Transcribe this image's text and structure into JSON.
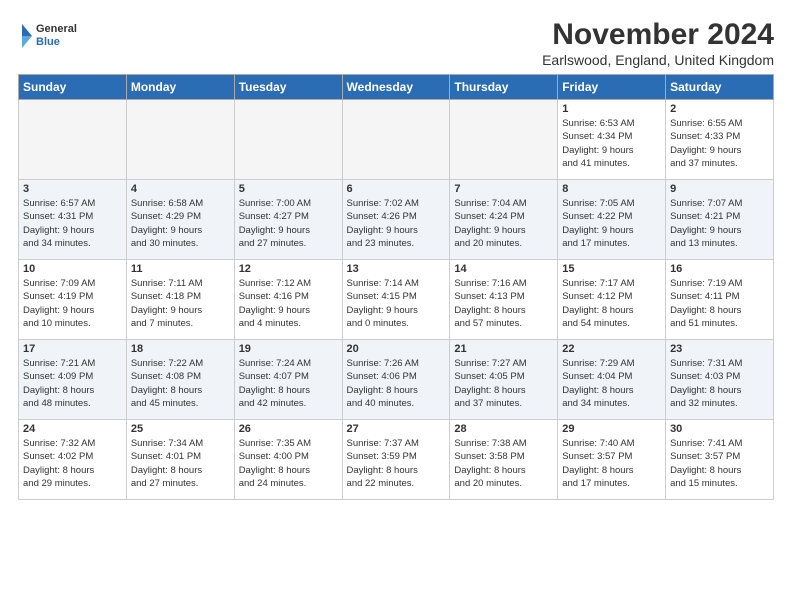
{
  "logo": {
    "general": "General",
    "blue": "Blue"
  },
  "title": "November 2024",
  "location": "Earlswood, England, United Kingdom",
  "weekdays": [
    "Sunday",
    "Monday",
    "Tuesday",
    "Wednesday",
    "Thursday",
    "Friday",
    "Saturday"
  ],
  "weeks": [
    [
      {
        "day": "",
        "info": ""
      },
      {
        "day": "",
        "info": ""
      },
      {
        "day": "",
        "info": ""
      },
      {
        "day": "",
        "info": ""
      },
      {
        "day": "",
        "info": ""
      },
      {
        "day": "1",
        "info": "Sunrise: 6:53 AM\nSunset: 4:34 PM\nDaylight: 9 hours\nand 41 minutes."
      },
      {
        "day": "2",
        "info": "Sunrise: 6:55 AM\nSunset: 4:33 PM\nDaylight: 9 hours\nand 37 minutes."
      }
    ],
    [
      {
        "day": "3",
        "info": "Sunrise: 6:57 AM\nSunset: 4:31 PM\nDaylight: 9 hours\nand 34 minutes."
      },
      {
        "day": "4",
        "info": "Sunrise: 6:58 AM\nSunset: 4:29 PM\nDaylight: 9 hours\nand 30 minutes."
      },
      {
        "day": "5",
        "info": "Sunrise: 7:00 AM\nSunset: 4:27 PM\nDaylight: 9 hours\nand 27 minutes."
      },
      {
        "day": "6",
        "info": "Sunrise: 7:02 AM\nSunset: 4:26 PM\nDaylight: 9 hours\nand 23 minutes."
      },
      {
        "day": "7",
        "info": "Sunrise: 7:04 AM\nSunset: 4:24 PM\nDaylight: 9 hours\nand 20 minutes."
      },
      {
        "day": "8",
        "info": "Sunrise: 7:05 AM\nSunset: 4:22 PM\nDaylight: 9 hours\nand 17 minutes."
      },
      {
        "day": "9",
        "info": "Sunrise: 7:07 AM\nSunset: 4:21 PM\nDaylight: 9 hours\nand 13 minutes."
      }
    ],
    [
      {
        "day": "10",
        "info": "Sunrise: 7:09 AM\nSunset: 4:19 PM\nDaylight: 9 hours\nand 10 minutes."
      },
      {
        "day": "11",
        "info": "Sunrise: 7:11 AM\nSunset: 4:18 PM\nDaylight: 9 hours\nand 7 minutes."
      },
      {
        "day": "12",
        "info": "Sunrise: 7:12 AM\nSunset: 4:16 PM\nDaylight: 9 hours\nand 4 minutes."
      },
      {
        "day": "13",
        "info": "Sunrise: 7:14 AM\nSunset: 4:15 PM\nDaylight: 9 hours\nand 0 minutes."
      },
      {
        "day": "14",
        "info": "Sunrise: 7:16 AM\nSunset: 4:13 PM\nDaylight: 8 hours\nand 57 minutes."
      },
      {
        "day": "15",
        "info": "Sunrise: 7:17 AM\nSunset: 4:12 PM\nDaylight: 8 hours\nand 54 minutes."
      },
      {
        "day": "16",
        "info": "Sunrise: 7:19 AM\nSunset: 4:11 PM\nDaylight: 8 hours\nand 51 minutes."
      }
    ],
    [
      {
        "day": "17",
        "info": "Sunrise: 7:21 AM\nSunset: 4:09 PM\nDaylight: 8 hours\nand 48 minutes."
      },
      {
        "day": "18",
        "info": "Sunrise: 7:22 AM\nSunset: 4:08 PM\nDaylight: 8 hours\nand 45 minutes."
      },
      {
        "day": "19",
        "info": "Sunrise: 7:24 AM\nSunset: 4:07 PM\nDaylight: 8 hours\nand 42 minutes."
      },
      {
        "day": "20",
        "info": "Sunrise: 7:26 AM\nSunset: 4:06 PM\nDaylight: 8 hours\nand 40 minutes."
      },
      {
        "day": "21",
        "info": "Sunrise: 7:27 AM\nSunset: 4:05 PM\nDaylight: 8 hours\nand 37 minutes."
      },
      {
        "day": "22",
        "info": "Sunrise: 7:29 AM\nSunset: 4:04 PM\nDaylight: 8 hours\nand 34 minutes."
      },
      {
        "day": "23",
        "info": "Sunrise: 7:31 AM\nSunset: 4:03 PM\nDaylight: 8 hours\nand 32 minutes."
      }
    ],
    [
      {
        "day": "24",
        "info": "Sunrise: 7:32 AM\nSunset: 4:02 PM\nDaylight: 8 hours\nand 29 minutes."
      },
      {
        "day": "25",
        "info": "Sunrise: 7:34 AM\nSunset: 4:01 PM\nDaylight: 8 hours\nand 27 minutes."
      },
      {
        "day": "26",
        "info": "Sunrise: 7:35 AM\nSunset: 4:00 PM\nDaylight: 8 hours\nand 24 minutes."
      },
      {
        "day": "27",
        "info": "Sunrise: 7:37 AM\nSunset: 3:59 PM\nDaylight: 8 hours\nand 22 minutes."
      },
      {
        "day": "28",
        "info": "Sunrise: 7:38 AM\nSunset: 3:58 PM\nDaylight: 8 hours\nand 20 minutes."
      },
      {
        "day": "29",
        "info": "Sunrise: 7:40 AM\nSunset: 3:57 PM\nDaylight: 8 hours\nand 17 minutes."
      },
      {
        "day": "30",
        "info": "Sunrise: 7:41 AM\nSunset: 3:57 PM\nDaylight: 8 hours\nand 15 minutes."
      }
    ]
  ]
}
